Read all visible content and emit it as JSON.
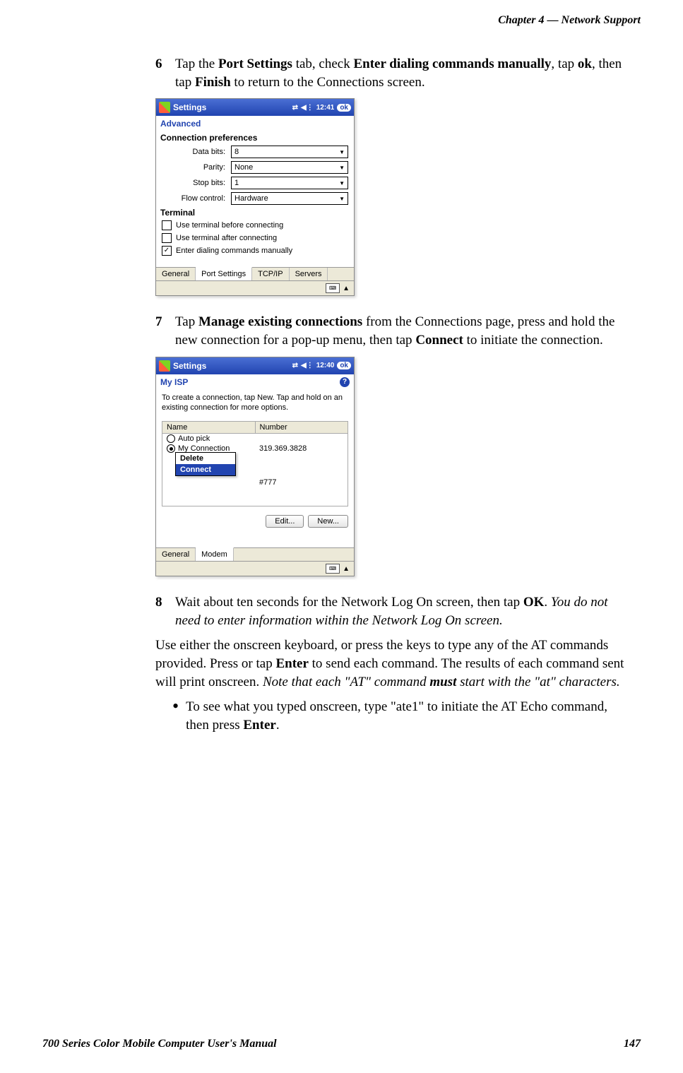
{
  "header": {
    "chapter": "Chapter  4",
    "dash": "—",
    "title": "Network Support"
  },
  "steps": {
    "s6": {
      "num": "6",
      "t1": "Tap the ",
      "b1": "Port Settings",
      "t2": " tab, check ",
      "b2": "Enter dialing commands manually",
      "t3": ", tap ",
      "b3": "ok",
      "t4": ", then tap ",
      "b4": "Finish",
      "t5": " to return to the Connections screen."
    },
    "s7": {
      "num": "7",
      "t1": "Tap ",
      "b1": "Manage existing connections",
      "t2": " from the Connections page, press and hold the new connection for a pop-up menu, then tap ",
      "b2": "Connect",
      "t3": " to initiate the connection."
    },
    "s8": {
      "num": "8",
      "t1": "Wait about ten seconds for the Network Log On screen, then tap ",
      "b1": "OK",
      "t2": ". ",
      "i1": "You do not need to enter information within the Network Log On screen."
    }
  },
  "screenshot1": {
    "title": "Settings",
    "time": "12:41",
    "ok": "ok",
    "sub": "Advanced",
    "section1": "Connection preferences",
    "rows": {
      "databits": {
        "label": "Data bits:",
        "value": "8"
      },
      "parity": {
        "label": "Parity:",
        "value": "None"
      },
      "stopbits": {
        "label": "Stop bits:",
        "value": "1"
      },
      "flow": {
        "label": "Flow control:",
        "value": "Hardware"
      }
    },
    "section2": "Terminal",
    "chk1": "Use terminal before connecting",
    "chk2": "Use terminal after connecting",
    "chk3": "Enter dialing commands manually",
    "tabs": [
      "General",
      "Port Settings",
      "TCP/IP",
      "Servers"
    ]
  },
  "screenshot2": {
    "title": "Settings",
    "time": "12:40",
    "ok": "ok",
    "sub": "My ISP",
    "body": "To create a connection, tap New. Tap and hold on an existing connection for more options.",
    "thead": {
      "c1": "Name",
      "c2": "Number"
    },
    "rows": [
      {
        "name": "Auto pick",
        "num": ""
      },
      {
        "name": "My Connection",
        "num": "319.369.3828"
      },
      {
        "name": "",
        "num": "#777"
      }
    ],
    "popup": {
      "opt1": "Delete",
      "opt2": "Connect"
    },
    "buttons": {
      "edit": "Edit...",
      "newb": "New..."
    },
    "tabs": [
      "General",
      "Modem"
    ]
  },
  "para1": {
    "t1": "Use either the onscreen keyboard, or press the keys to type any of the AT commands provided. Press or tap ",
    "b1": "Enter",
    "t2": " to send each command. The results of each command sent will print onscreen. ",
    "i1": "Note that each \"AT\" command ",
    "bi1": "must",
    "i2": " start with the \"at\" characters."
  },
  "bullet1": {
    "t1": "To see what you typed onscreen, type \"ate1\" to initiate the AT Echo command, then press ",
    "b1": "Enter",
    "t2": "."
  },
  "footer": {
    "left": "700 Series Color Mobile Computer User's Manual",
    "page": "147"
  }
}
